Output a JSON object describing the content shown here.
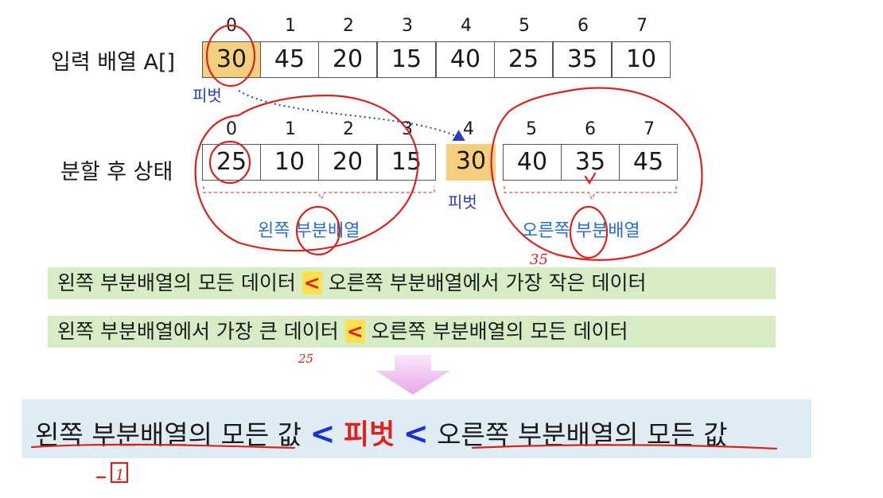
{
  "input": {
    "label": "입력 배열 A[]",
    "indices": [
      "0",
      "1",
      "2",
      "3",
      "4",
      "5",
      "6",
      "7"
    ],
    "values": [
      "30",
      "45",
      "20",
      "15",
      "40",
      "25",
      "35",
      "10"
    ],
    "pivot_label": "피벗"
  },
  "partition": {
    "label": "분할 후 상태",
    "left_indices": [
      "0",
      "1",
      "2",
      "3"
    ],
    "left_values": [
      "25",
      "10",
      "20",
      "15"
    ],
    "pivot_index": "4",
    "pivot_value": "30",
    "right_indices": [
      "5",
      "6",
      "7"
    ],
    "right_values": [
      "40",
      "35",
      "45"
    ],
    "pivot_label": "피벗",
    "left_caption": "왼쪽 부분배열",
    "right_caption": "오른쪽 부분배열"
  },
  "rules": [
    {
      "left": "왼쪽 부분배열의 모든 데이터",
      "op": "<",
      "right": "오른쪽 부분배열에서 가장 작은 데이터"
    },
    {
      "left": "왼쪽 부분배열에서 가장 큰 데이터",
      "op": "<",
      "right": "오른쪽 부분배열의 모든 데이터"
    }
  ],
  "conclusion": {
    "left": "왼쪽 부분배열의 모든 값",
    "op1": "<",
    "pivot": "피벗",
    "op2": "<",
    "right": "오른쪽 부분배열의 모든 값"
  },
  "annotations": {
    "note_35": "35",
    "note_25": "25",
    "note_1": "1"
  },
  "colors": {
    "pivot_fill": "#f5cf7f",
    "band_green": "#d7ecc4",
    "final_band": "#dfecf4",
    "pen_red": "#d8231f",
    "arrow_blue": "#2a3fbf"
  }
}
